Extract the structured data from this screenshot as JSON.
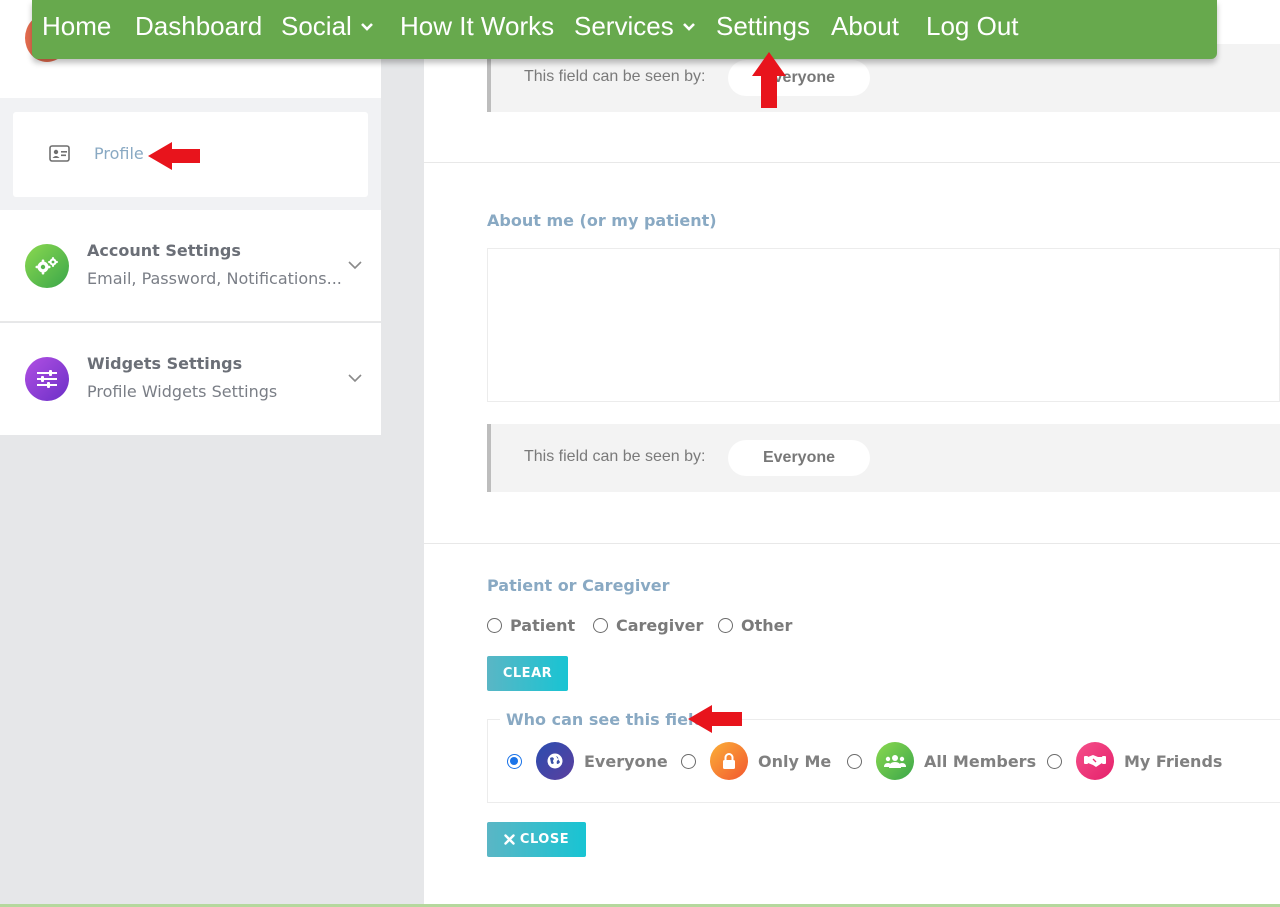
{
  "nav": {
    "home": "Home",
    "dashboard": "Dashboard",
    "social": "Social",
    "how_it_works": "How It Works",
    "services": "Services",
    "settings": "Settings",
    "about": "About",
    "log_out": "Log Out",
    "color": "#67a94d"
  },
  "sidebar": {
    "profile_label": "Profile",
    "account": {
      "title": "Account Settings",
      "subtitle": "Email, Password, Notifications..."
    },
    "widgets": {
      "title": "Widgets Settings",
      "subtitle": "Profile Widgets Settings"
    }
  },
  "main": {
    "top_visibility": {
      "label": "This field can be seen by:",
      "value": "Everyone"
    },
    "about_me": {
      "label": "About me (or my patient)",
      "value": "",
      "visibility_label": "This field can be seen by:",
      "visibility_value": "Everyone"
    },
    "patient_or_caregiver": {
      "label": "Patient or Caregiver",
      "options": [
        "Patient",
        "Caregiver",
        "Other"
      ],
      "clear_button": "CLEAR"
    },
    "who_can_see": {
      "legend": "Who can see this field?",
      "options": [
        "Everyone",
        "Only Me",
        "All Members",
        "My Friends"
      ],
      "selected": "Everyone"
    },
    "close_button": "CLOSE"
  },
  "colors": {
    "accent_teal": "#18c4d3",
    "label_blue": "#89a9c3",
    "annotation_red": "#e8141c"
  }
}
